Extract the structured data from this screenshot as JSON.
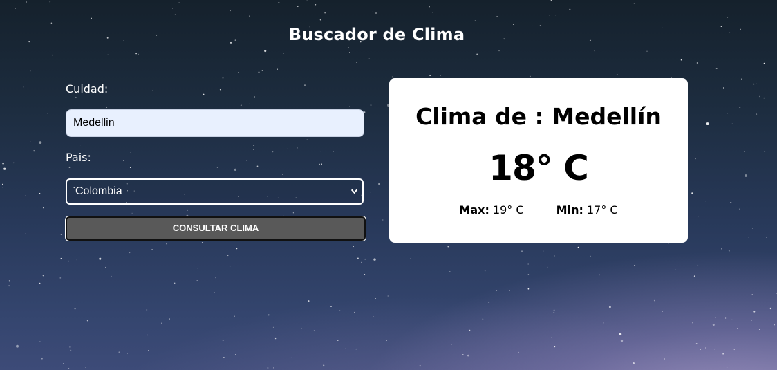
{
  "header": {
    "title": "Buscador de Clima"
  },
  "form": {
    "city_label": "Cuidad:",
    "city_value": "Medellin",
    "country_label": "Pais:",
    "country_selected": "Colombia",
    "submit_label": "CONSULTAR CLIMA"
  },
  "result": {
    "title": "Clima de : Medellín",
    "temperature": "18° C",
    "max_label": "Max:",
    "max_value": "19° C",
    "min_label": "Min:",
    "min_value": "17° C"
  },
  "colors": {
    "input_background": "#e8f0fe",
    "button_background": "#595959",
    "card_background": "#ffffff"
  }
}
